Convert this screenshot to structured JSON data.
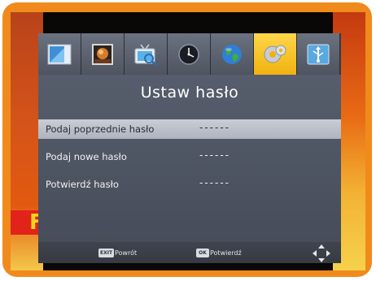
{
  "menu": {
    "tabs": [
      {
        "name": "picture-icon",
        "active": false
      },
      {
        "name": "photo-icon",
        "active": false
      },
      {
        "name": "tv-search-icon",
        "active": false
      },
      {
        "name": "clock-icon",
        "active": false
      },
      {
        "name": "globe-icon",
        "active": false
      },
      {
        "name": "settings-icon",
        "active": true
      },
      {
        "name": "usb-icon",
        "active": false
      }
    ]
  },
  "dialog": {
    "title": "Ustaw hasło",
    "rows": [
      {
        "label": "Podaj poprzednie hasło",
        "value": "------",
        "selected": true
      },
      {
        "label": "Podaj nowe hasło",
        "value": "------",
        "selected": false
      },
      {
        "label": "Potwierdź hasło",
        "value": "------",
        "selected": false
      }
    ]
  },
  "footer": {
    "back_key": "EXIT",
    "back_label": "Powrót",
    "ok_key": "OK",
    "ok_label": "Potwierdź"
  },
  "background": {
    "partial_letter": "F"
  },
  "colors": {
    "frame": "#f08a1c",
    "active_tab": "#f0b210",
    "panel": "#4d5462",
    "selected_row": "#bfc3cc"
  }
}
